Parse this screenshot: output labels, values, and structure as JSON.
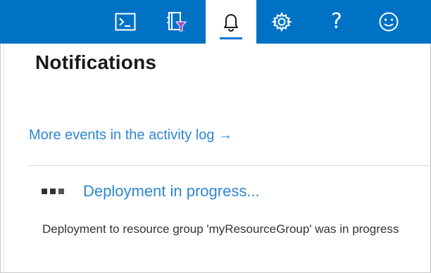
{
  "toolbar": {
    "buttons": [
      {
        "name": "cloud-shell",
        "icon": "terminal-icon"
      },
      {
        "name": "directory-filter",
        "icon": "directory-filter-icon"
      },
      {
        "name": "notifications",
        "icon": "bell-icon",
        "active": true
      },
      {
        "name": "settings",
        "icon": "gear-icon"
      },
      {
        "name": "help",
        "icon": "question-icon",
        "glyph": "?"
      },
      {
        "name": "feedback",
        "icon": "smiley-icon"
      }
    ],
    "accent": "#0072c6"
  },
  "panel": {
    "title": "Notifications",
    "activity_link": "More events in the activity log →"
  },
  "notification": {
    "title": "Deployment in progress...",
    "description": "Deployment to resource group 'myResourceGroup' was in progress",
    "link_color": "#2e87d1"
  }
}
